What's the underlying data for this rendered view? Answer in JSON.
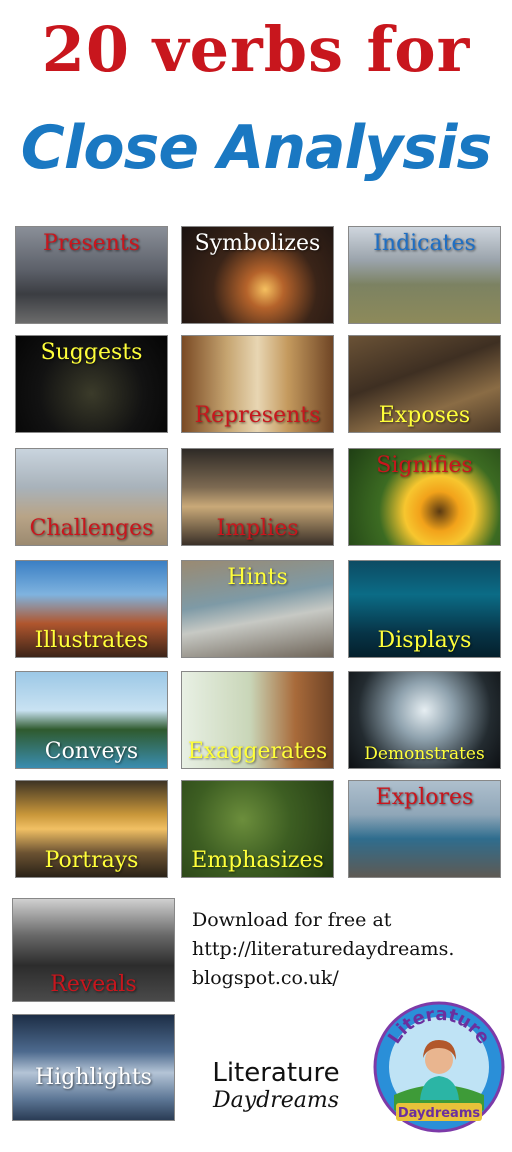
{
  "title": {
    "line1": "20 verbs for",
    "line2": "Close Analysis"
  },
  "tiles": [
    {
      "label": "Presents",
      "color": "#c8161d"
    },
    {
      "label": "Symbolizes",
      "color": "#ffffff"
    },
    {
      "label": "Indicates",
      "color": "#1f6fc4"
    },
    {
      "label": "Suggests",
      "color": "#ffff3a"
    },
    {
      "label": "Represents",
      "color": "#c8161d"
    },
    {
      "label": "Exposes",
      "color": "#ffff3a"
    },
    {
      "label": "Challenges",
      "color": "#c8161d"
    },
    {
      "label": "Implies",
      "color": "#c8161d"
    },
    {
      "label": "Signifies",
      "color": "#c8161d"
    },
    {
      "label": "Illustrates",
      "color": "#ffff3a"
    },
    {
      "label": "Hints",
      "color": "#ffff3a"
    },
    {
      "label": "Displays",
      "color": "#ffff3a"
    },
    {
      "label": "Conveys",
      "color": "#ffffff"
    },
    {
      "label": "Exaggerates",
      "color": "#ffff3a"
    },
    {
      "label": "Demonstrates",
      "color": "#ffff3a"
    },
    {
      "label": "Portrays",
      "color": "#ffff3a"
    },
    {
      "label": "Emphasizes",
      "color": "#ffff3a"
    },
    {
      "label": "Explores",
      "color": "#c8161d"
    },
    {
      "label": "Reveals",
      "color": "#c8161d"
    },
    {
      "label": "Highlights",
      "color": "#ffffff"
    }
  ],
  "download": {
    "line1": "Download for free at",
    "line2": "http://literaturedaydreams.",
    "line3": "blogspot.co.uk/"
  },
  "logo": {
    "word1": "Literature",
    "word2": "Daydreams"
  },
  "badge": {
    "word1": "Literature",
    "word2": "Daydreams"
  }
}
